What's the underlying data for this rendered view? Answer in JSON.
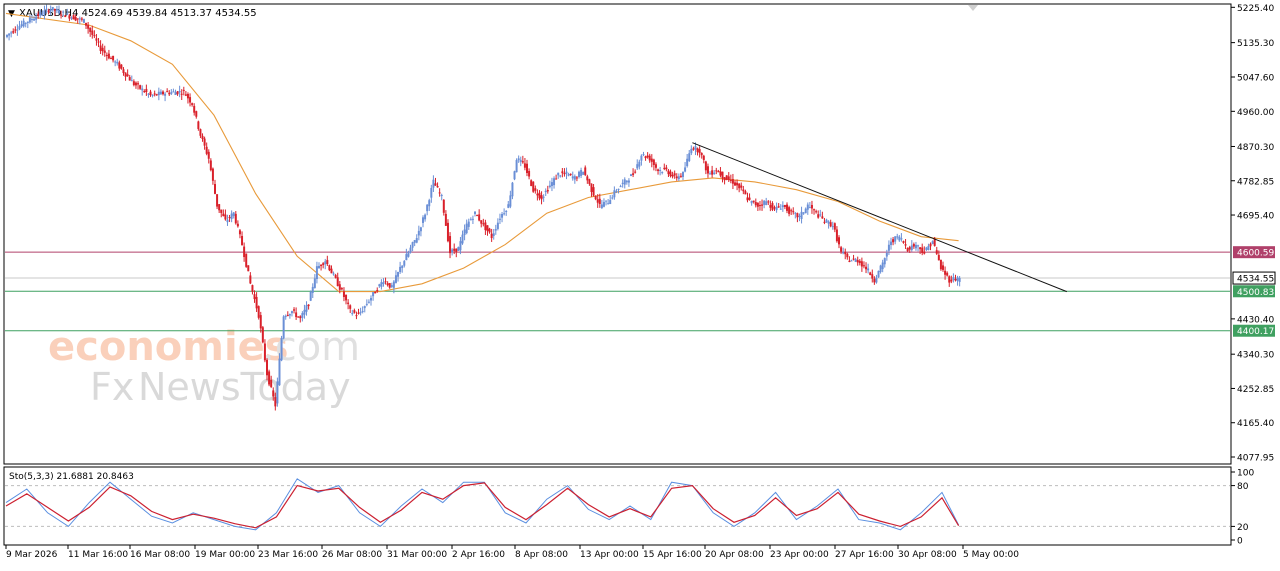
{
  "header": {
    "triangle": "▼",
    "info": "XAUUSD,H4  4524.69 4539.84 4513.37 4534.55"
  },
  "watermark": {
    "brand": "economies",
    "domain": ".com",
    "fx": "Fx",
    "news": "NewsToday"
  },
  "colors": {
    "bull": "#6a8fd6",
    "bear": "#d9202a",
    "ma": "#e89a3a",
    "trend": "#111111",
    "resistance": "#b0406a",
    "support": "#3fa060",
    "stoch_k": "#5a8fe0",
    "stoch_d": "#cc2030"
  },
  "chart_data": [
    {
      "type": "candlestick",
      "symbol": "XAUUSD",
      "timeframe": "H4",
      "ohlc_header": {
        "open": 4524.69,
        "high": 4539.84,
        "low": 4513.37,
        "close": 4534.55
      },
      "ylim": [
        4077.95,
        5290
      ],
      "y_ticks": [
        "5225.40",
        "5135.30",
        "5047.60",
        "4960.00",
        "4870.30",
        "4782.85",
        "4695.40",
        "4600.59",
        "4534.55",
        "4500.83",
        "4430.40",
        "4400.17",
        "4340.30",
        "4252.85",
        "4165.40",
        "4077.95"
      ],
      "x_ticks": [
        "9 Mar 2026",
        "11 Mar 16:00",
        "16 Mar 08:00",
        "19 Mar 00:00",
        "23 Mar 16:00",
        "26 Mar 08:00",
        "31 Mar 00:00",
        "2 Apr 16:00",
        "8 Apr 08:00",
        "13 Apr 00:00",
        "15 Apr 16:00",
        "20 Apr 08:00",
        "23 Apr 00:00",
        "27 Apr 16:00",
        "30 Apr 08:00",
        "5 May 00:00"
      ],
      "price_path": [
        [
          0,
          5150
        ],
        [
          6,
          5175
        ],
        [
          14,
          5200
        ],
        [
          22,
          5222
        ],
        [
          30,
          5205
        ],
        [
          38,
          5190
        ],
        [
          46,
          5120
        ],
        [
          54,
          5080
        ],
        [
          62,
          5030
        ],
        [
          70,
          5000
        ],
        [
          78,
          5008
        ],
        [
          86,
          5010
        ],
        [
          90,
          4980
        ],
        [
          94,
          4900
        ],
        [
          98,
          4840
        ],
        [
          102,
          4720
        ],
        [
          106,
          4680
        ],
        [
          110,
          4700
        ],
        [
          114,
          4620
        ],
        [
          118,
          4520
        ],
        [
          122,
          4440
        ],
        [
          126,
          4290
        ],
        [
          130,
          4210
        ],
        [
          134,
          4440
        ],
        [
          138,
          4450
        ],
        [
          142,
          4430
        ],
        [
          146,
          4470
        ],
        [
          150,
          4560
        ],
        [
          154,
          4580
        ],
        [
          158,
          4540
        ],
        [
          162,
          4500
        ],
        [
          166,
          4450
        ],
        [
          170,
          4440
        ],
        [
          174,
          4470
        ],
        [
          178,
          4500
        ],
        [
          182,
          4530
        ],
        [
          186,
          4510
        ],
        [
          190,
          4560
        ],
        [
          194,
          4600
        ],
        [
          198,
          4640
        ],
        [
          202,
          4700
        ],
        [
          206,
          4780
        ],
        [
          210,
          4740
        ],
        [
          214,
          4600
        ],
        [
          218,
          4610
        ],
        [
          222,
          4670
        ],
        [
          226,
          4700
        ],
        [
          230,
          4670
        ],
        [
          234,
          4640
        ],
        [
          238,
          4690
        ],
        [
          242,
          4720
        ],
        [
          246,
          4840
        ],
        [
          250,
          4820
        ],
        [
          254,
          4760
        ],
        [
          258,
          4740
        ],
        [
          262,
          4770
        ],
        [
          266,
          4800
        ],
        [
          270,
          4800
        ],
        [
          274,
          4790
        ],
        [
          278,
          4810
        ],
        [
          282,
          4760
        ],
        [
          286,
          4720
        ],
        [
          290,
          4730
        ],
        [
          294,
          4760
        ],
        [
          298,
          4780
        ],
        [
          302,
          4800
        ],
        [
          306,
          4850
        ],
        [
          310,
          4840
        ],
        [
          314,
          4810
        ],
        [
          318,
          4810
        ],
        [
          322,
          4790
        ],
        [
          326,
          4800
        ],
        [
          330,
          4870
        ],
        [
          334,
          4860
        ],
        [
          338,
          4800
        ],
        [
          342,
          4810
        ],
        [
          346,
          4790
        ],
        [
          350,
          4780
        ],
        [
          354,
          4760
        ],
        [
          358,
          4730
        ],
        [
          362,
          4720
        ],
        [
          366,
          4730
        ],
        [
          370,
          4710
        ],
        [
          374,
          4720
        ],
        [
          378,
          4700
        ],
        [
          382,
          4690
        ],
        [
          386,
          4720
        ],
        [
          390,
          4700
        ],
        [
          394,
          4680
        ],
        [
          398,
          4670
        ],
        [
          402,
          4600
        ],
        [
          406,
          4580
        ],
        [
          410,
          4580
        ],
        [
          414,
          4560
        ],
        [
          418,
          4530
        ],
        [
          422,
          4570
        ],
        [
          426,
          4630
        ],
        [
          430,
          4640
        ],
        [
          434,
          4610
        ],
        [
          438,
          4620
        ],
        [
          442,
          4600
        ],
        [
          446,
          4630
        ],
        [
          450,
          4560
        ],
        [
          454,
          4530
        ],
        [
          458,
          4534.55
        ]
      ],
      "moving_average": [
        [
          0,
          5210
        ],
        [
          40,
          5180
        ],
        [
          60,
          5140
        ],
        [
          80,
          5080
        ],
        [
          100,
          4950
        ],
        [
          120,
          4750
        ],
        [
          140,
          4590
        ],
        [
          160,
          4500
        ],
        [
          180,
          4500
        ],
        [
          200,
          4520
        ],
        [
          220,
          4560
        ],
        [
          240,
          4620
        ],
        [
          260,
          4700
        ],
        [
          280,
          4740
        ],
        [
          300,
          4760
        ],
        [
          320,
          4780
        ],
        [
          340,
          4790
        ],
        [
          360,
          4780
        ],
        [
          380,
          4760
        ],
        [
          400,
          4730
        ],
        [
          420,
          4680
        ],
        [
          440,
          4640
        ],
        [
          458,
          4630
        ]
      ],
      "trendline": {
        "from": [
          330,
          4880
        ],
        "to": [
          510,
          4500
        ]
      },
      "levels": [
        {
          "label": "4600.59",
          "value": 4600.59,
          "role": "resistance"
        },
        {
          "label": "4534.55",
          "value": 4534.55,
          "role": "current"
        },
        {
          "label": "4500.83",
          "value": 4500.83,
          "role": "support"
        },
        {
          "label": "4400.17",
          "value": 4400.17,
          "role": "support"
        }
      ]
    },
    {
      "type": "line",
      "title": "Sto(5,3,3) 21.6881 20.8463",
      "ylim": [
        0,
        100
      ],
      "y_ticks": [
        "100",
        "80",
        "20",
        "0"
      ],
      "levels": [
        80,
        20
      ],
      "k": [
        [
          0,
          55
        ],
        [
          10,
          75
        ],
        [
          20,
          40
        ],
        [
          30,
          20
        ],
        [
          40,
          55
        ],
        [
          50,
          85
        ],
        [
          60,
          60
        ],
        [
          70,
          35
        ],
        [
          80,
          25
        ],
        [
          90,
          40
        ],
        [
          100,
          30
        ],
        [
          110,
          20
        ],
        [
          120,
          15
        ],
        [
          130,
          40
        ],
        [
          140,
          90
        ],
        [
          150,
          70
        ],
        [
          160,
          80
        ],
        [
          170,
          40
        ],
        [
          180,
          20
        ],
        [
          190,
          50
        ],
        [
          200,
          75
        ],
        [
          210,
          55
        ],
        [
          220,
          85
        ],
        [
          230,
          85
        ],
        [
          240,
          40
        ],
        [
          250,
          25
        ],
        [
          260,
          60
        ],
        [
          270,
          80
        ],
        [
          280,
          45
        ],
        [
          290,
          30
        ],
        [
          300,
          50
        ],
        [
          310,
          30
        ],
        [
          320,
          85
        ],
        [
          330,
          80
        ],
        [
          340,
          40
        ],
        [
          350,
          20
        ],
        [
          360,
          40
        ],
        [
          370,
          70
        ],
        [
          380,
          30
        ],
        [
          390,
          50
        ],
        [
          400,
          75
        ],
        [
          410,
          30
        ],
        [
          420,
          25
        ],
        [
          430,
          15
        ],
        [
          440,
          40
        ],
        [
          450,
          70
        ],
        [
          458,
          22
        ]
      ],
      "d": [
        [
          0,
          50
        ],
        [
          10,
          68
        ],
        [
          20,
          48
        ],
        [
          30,
          28
        ],
        [
          40,
          48
        ],
        [
          50,
          78
        ],
        [
          60,
          65
        ],
        [
          70,
          42
        ],
        [
          80,
          30
        ],
        [
          90,
          38
        ],
        [
          100,
          32
        ],
        [
          110,
          24
        ],
        [
          120,
          18
        ],
        [
          130,
          34
        ],
        [
          140,
          80
        ],
        [
          150,
          72
        ],
        [
          160,
          76
        ],
        [
          170,
          48
        ],
        [
          180,
          26
        ],
        [
          190,
          44
        ],
        [
          200,
          70
        ],
        [
          210,
          60
        ],
        [
          220,
          80
        ],
        [
          230,
          84
        ],
        [
          240,
          48
        ],
        [
          250,
          30
        ],
        [
          260,
          52
        ],
        [
          270,
          76
        ],
        [
          280,
          52
        ],
        [
          290,
          34
        ],
        [
          300,
          46
        ],
        [
          310,
          34
        ],
        [
          320,
          76
        ],
        [
          330,
          80
        ],
        [
          340,
          46
        ],
        [
          350,
          26
        ],
        [
          360,
          36
        ],
        [
          370,
          62
        ],
        [
          380,
          36
        ],
        [
          390,
          46
        ],
        [
          400,
          70
        ],
        [
          410,
          38
        ],
        [
          420,
          28
        ],
        [
          430,
          20
        ],
        [
          440,
          34
        ],
        [
          450,
          62
        ],
        [
          458,
          21
        ]
      ]
    }
  ]
}
